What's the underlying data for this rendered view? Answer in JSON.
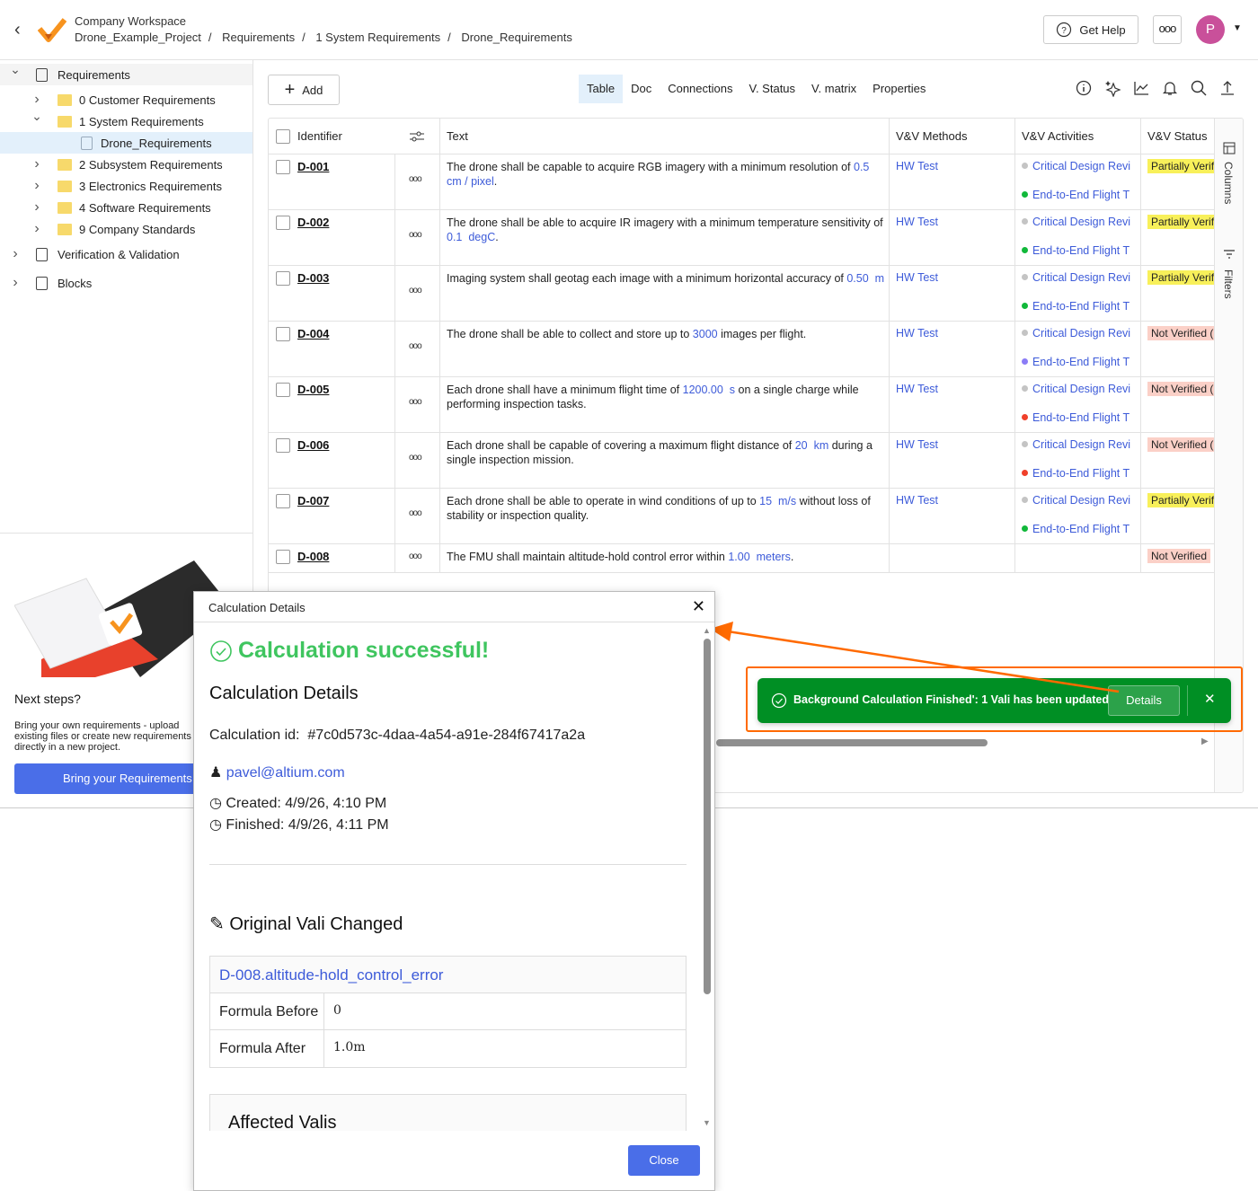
{
  "header": {
    "workspace": "Company Workspace",
    "breadcrumbs": [
      "Drone_Example_Project",
      "Requirements",
      "1 System Requirements",
      "Drone_Requirements"
    ],
    "get_help": "Get Help",
    "more": "ooo",
    "avatar_initial": "P",
    "avatar_color": "#c9509a"
  },
  "sidebar": {
    "items": [
      {
        "label": "Requirements",
        "level": 0,
        "expanded": true,
        "icon": "requirements-icon"
      },
      {
        "label": "0 Customer Requirements",
        "level": 1,
        "expanded": false,
        "icon": "folder-icon"
      },
      {
        "label": "1 System Requirements",
        "level": 1,
        "expanded": true,
        "icon": "folder-icon"
      },
      {
        "label": "Drone_Requirements",
        "level": 2,
        "selected": true,
        "icon": "document-icon"
      },
      {
        "label": "2 Subsystem Requirements",
        "level": 1,
        "expanded": false,
        "icon": "folder-icon"
      },
      {
        "label": "3 Electronics Requirements",
        "level": 1,
        "expanded": false,
        "icon": "folder-icon"
      },
      {
        "label": "4 Software Requirements",
        "level": 1,
        "expanded": false,
        "icon": "folder-icon"
      },
      {
        "label": "9 Company Standards",
        "level": 1,
        "expanded": false,
        "icon": "folder-icon"
      },
      {
        "label": "Verification & Validation",
        "level": 0,
        "expanded": false,
        "icon": "verification-icon"
      },
      {
        "label": "Blocks",
        "level": 0,
        "expanded": false,
        "icon": "blocks-icon"
      }
    ],
    "promo": {
      "title": "Next steps?",
      "text": "Bring your own requirements - upload existing files or create new requirements directly in a new project.",
      "button": "Bring your Requirements"
    }
  },
  "toolbar": {
    "add": "Add",
    "tabs": [
      "Table",
      "Doc",
      "Connections",
      "V. Status",
      "V. matrix",
      "Properties"
    ],
    "active_tab": "Table"
  },
  "table": {
    "columns": [
      "Identifier",
      "Text",
      "V&V Methods",
      "V&V Activities",
      "V&V Status"
    ],
    "side_tabs": [
      "Columns",
      "Filters"
    ],
    "rows": [
      {
        "id": "D-001",
        "before": "The drone shall be capable to acquire RGB imagery with a minimum resolution of ",
        "value": "0.5",
        "unit": "cm / pixel",
        "after": ".",
        "method": "HW Test",
        "activities": [
          {
            "name": "Critical Design Revi",
            "dot": "#c4c4c4"
          },
          {
            "name": "End-to-End Flight T",
            "dot": "#11b83a"
          }
        ],
        "status": "Partially Verif",
        "status_color": "#f8f05a"
      },
      {
        "id": "D-002",
        "before": "The drone shall be able to acquire IR imagery with a minimum temperature sensitivity of ",
        "value": "0.1",
        "unit": "degC",
        "after": ".",
        "method": "HW Test",
        "activities": [
          {
            "name": "Critical Design Revi",
            "dot": "#c4c4c4"
          },
          {
            "name": "End-to-End Flight T",
            "dot": "#11b83a"
          }
        ],
        "status": "Partially Verif",
        "status_color": "#f8f05a"
      },
      {
        "id": "D-003",
        "before": "Imaging system shall geotag each image with a minimum horizontal accuracy of ",
        "value": "0.50",
        "unit": "m",
        "after": "",
        "method": "HW Test",
        "activities": [
          {
            "name": "Critical Design Revi",
            "dot": "#c4c4c4"
          },
          {
            "name": "End-to-End Flight T",
            "dot": "#11b83a"
          }
        ],
        "status": "Partially Verif",
        "status_color": "#f8f05a"
      },
      {
        "id": "D-004",
        "before": "The drone shall be able to collect and store up to ",
        "value": "3000",
        "unit": "",
        "after": " images per flight.",
        "method": "HW Test",
        "activities": [
          {
            "name": "Critical Design Revi",
            "dot": "#c4c4c4"
          },
          {
            "name": "End-to-End Flight T",
            "dot": "#8b7cf6"
          }
        ],
        "status": "Not Verified (",
        "status_color": "#fbd0c7"
      },
      {
        "id": "D-005",
        "before": "Each drone shall have a minimum flight time of ",
        "value": "1200.00",
        "unit": "s",
        "after": " on a single charge while performing inspection tasks.",
        "method": "HW Test",
        "activities": [
          {
            "name": "Critical Design Revi",
            "dot": "#c4c4c4"
          },
          {
            "name": "End-to-End Flight T",
            "dot": "#f0402a"
          }
        ],
        "status": "Not Verified (",
        "status_color": "#fbd0c7"
      },
      {
        "id": "D-006",
        "before": "Each drone shall be capable of covering a maximum flight distance of ",
        "value": "20",
        "unit": "km",
        "after": " during a single inspection mission.",
        "method": "HW Test",
        "activities": [
          {
            "name": "Critical Design Revi",
            "dot": "#c4c4c4"
          },
          {
            "name": "End-to-End Flight T",
            "dot": "#f0402a"
          }
        ],
        "status": "Not Verified (",
        "status_color": "#fbd0c7"
      },
      {
        "id": "D-007",
        "before": "Each drone shall be able to operate in wind conditions of up to ",
        "value": "15",
        "unit": "m/s",
        "after": " without loss of stability or inspection quality.",
        "method": "HW Test",
        "activities": [
          {
            "name": "Critical Design Revi",
            "dot": "#c4c4c4"
          },
          {
            "name": "End-to-End Flight T",
            "dot": "#11b83a"
          }
        ],
        "status": "Partially Verif",
        "status_color": "#f8f05a"
      },
      {
        "id": "D-008",
        "before": "The FMU shall maintain altitude-hold control error within ",
        "value": "1.00",
        "unit": "meters",
        "after": ".",
        "method": "",
        "activities": [],
        "status": "Not Verified",
        "status_color": "#fbd0c7"
      }
    ]
  },
  "toast": {
    "message": "Background Calculation Finished': 1 Vali has been updated.",
    "details": "Details",
    "color": "#008f24"
  },
  "modal": {
    "title": "Calculation Details",
    "success": "Calculation successful!",
    "heading": "Calculation Details",
    "calc_id_label": "Calculation id:",
    "calc_id": "#7c0d573c-4daa-4a54-a91e-284f67417a2a",
    "user": "pavel@altium.com",
    "created": "Created: 4/9/26, 4:10 PM",
    "finished": "Finished: 4/9/26, 4:11 PM",
    "changed_title": "Original Vali Changed",
    "vali_name": "D-008.altitude-hold_control_error",
    "formula_before_label": "Formula Before",
    "formula_before": "0",
    "formula_after_label": "Formula After",
    "formula_after": "1.0m",
    "affected_title": "Affected Valis",
    "close": "Close"
  }
}
